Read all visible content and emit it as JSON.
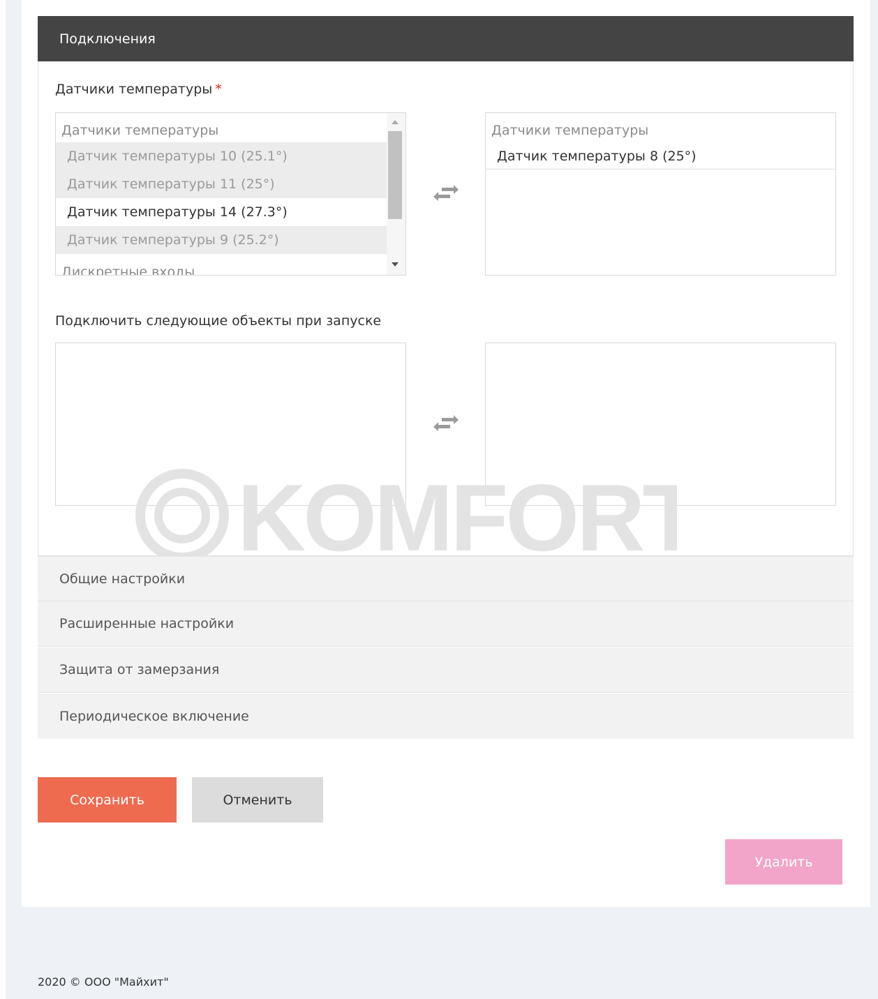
{
  "section": {
    "title": "Подключения"
  },
  "temp_sensors": {
    "label": "Датчики температуры",
    "required_mark": "*",
    "available": {
      "group_label": "Датчики температуры",
      "options": [
        {
          "label": "Датчик температуры 10 (25.1°)",
          "selected": true
        },
        {
          "label": "Датчик температуры 11 (25°)",
          "selected": true
        },
        {
          "label": "Датчик температуры 14 (27.3°)",
          "selected": false
        },
        {
          "label": "Датчик температуры 9 (25.2°)",
          "selected": true
        }
      ],
      "next_group_label": "Дискретные входы"
    },
    "chosen": {
      "group_label": "Датчики температуры",
      "options": [
        {
          "label": "Датчик температуры 8 (25°)"
        }
      ]
    }
  },
  "startup_objects": {
    "label": "Подключить следующие объекты при запуске"
  },
  "accordion": [
    {
      "label": "Общие настройки"
    },
    {
      "label": "Расширенные настройки"
    },
    {
      "label": "Защита от замерзания"
    },
    {
      "label": "Периодическое включение"
    }
  ],
  "buttons": {
    "save": "Сохранить",
    "cancel": "Отменить",
    "delete": "Удалить"
  },
  "watermark": {
    "text": "KOMFORT"
  },
  "footer": {
    "text": "2020 © ООО \"Майхит\""
  },
  "colors": {
    "header_bg": "#444444",
    "save_bg": "#ee6b50",
    "cancel_bg": "#dcdcdc",
    "delete_bg": "#f2a5c8",
    "required": "#e0201a",
    "page_bg": "#eef1f6"
  },
  "icons": {
    "swap": "swap-arrows-icon",
    "scroll_up": "chevron-up-icon",
    "scroll_down": "chevron-down-icon"
  }
}
